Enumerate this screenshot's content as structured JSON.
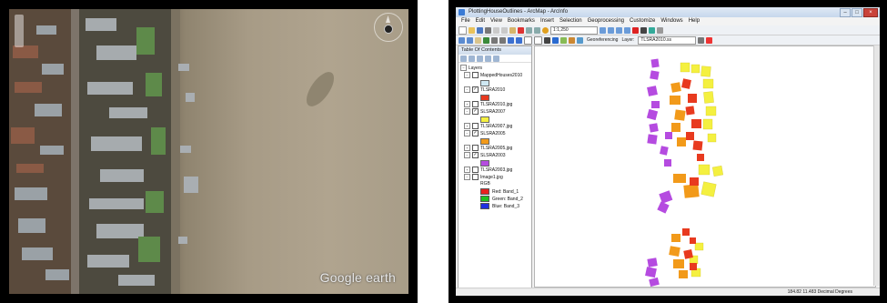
{
  "aerial": {
    "watermark": "Google earth"
  },
  "arcmap": {
    "window_title": "PlottingHouseOutlines - ArcMap - ArcInfo",
    "menu": [
      "File",
      "Edit",
      "View",
      "Bookmarks",
      "Insert",
      "Selection",
      "Geoprocessing",
      "Customize",
      "Windows",
      "Help"
    ],
    "scale": "1:1,250",
    "georeferencing_label": "Georeferencing",
    "layer_label": "Layer:",
    "layer_value": "TLSRA2010.ss",
    "toc": {
      "title": "Table Of Contents",
      "root": "Layers",
      "layers": [
        {
          "name": "MappedHouses2010",
          "checked": false,
          "swatch": "#cfe8f3"
        },
        {
          "name": "TLSRA2010",
          "checked": true,
          "swatch": "#e83a1f"
        },
        {
          "name": "TLSRA2010.jpg",
          "checked": false
        },
        {
          "name": "SLSRA2007",
          "checked": true,
          "swatch": "#f4f040"
        },
        {
          "name": "TLSRA2007.jpg",
          "checked": false
        },
        {
          "name": "SLSRA2005",
          "checked": true,
          "swatch": "#f29a1a"
        },
        {
          "name": "TLSRA2005.jpg",
          "checked": false
        },
        {
          "name": "SLSRA2003",
          "checked": true,
          "swatch": "#b54be0"
        },
        {
          "name": "TLSRA2003.jpg",
          "checked": false
        },
        {
          "name": "Image1.jpg",
          "checked": false
        }
      ],
      "rgb_label": "RGB",
      "bands": [
        {
          "label": "Red: Band_1",
          "color": "#e82020"
        },
        {
          "label": "Green: Band_2",
          "color": "#20c020"
        },
        {
          "label": "Blue: Band_3",
          "color": "#2030e0"
        }
      ]
    },
    "status_coords": "184.82  11.483 Decimal Degrees",
    "colors": {
      "house_2010": "#e83a1f",
      "house_2007": "#f4f040",
      "house_2005": "#f29a1a",
      "house_2003": "#b54be0"
    }
  }
}
